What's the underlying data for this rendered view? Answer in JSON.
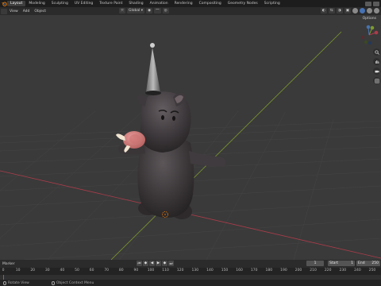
{
  "topbar": {
    "tabs": [
      "Layout",
      "Modeling",
      "Sculpting",
      "UV Editing",
      "Texture Paint",
      "Shading",
      "Animation",
      "Rendering",
      "Compositing",
      "Geometry Nodes",
      "Scripting"
    ]
  },
  "header": {
    "menus": [
      "View",
      "Add",
      "Object"
    ],
    "transform_orientation": "Global",
    "options_label": "Options"
  },
  "timeline": {
    "mode_label": "Marker",
    "current_frame": "1",
    "start_label": "Start",
    "start_value": "1",
    "end_label": "End",
    "end_value": "250",
    "ticks": [
      "0",
      "10",
      "20",
      "30",
      "40",
      "50",
      "60",
      "70",
      "80",
      "90",
      "100",
      "110",
      "120",
      "130",
      "140",
      "150",
      "160",
      "170",
      "180",
      "190",
      "200",
      "210",
      "220",
      "230",
      "240",
      "250"
    ]
  },
  "status": {
    "left_label": "Rotate View",
    "middle_label": "Object Context Menu"
  },
  "colors": {
    "accent": "#4772b3",
    "x_axis": "#ab3c4a",
    "y_axis": "#7d9a2e",
    "character": "#3b3739"
  }
}
